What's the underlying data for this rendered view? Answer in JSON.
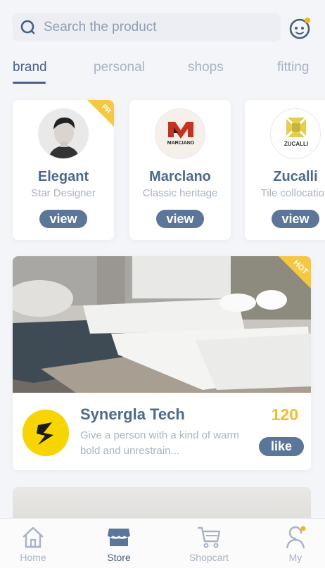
{
  "search": {
    "placeholder": "Search the product"
  },
  "tabs": [
    {
      "label": "brand",
      "active": true
    },
    {
      "label": "personal",
      "active": false
    },
    {
      "label": "shops",
      "active": false
    },
    {
      "label": "fitting",
      "active": false
    }
  ],
  "brands": [
    {
      "name": "Elegant",
      "subtitle": "Star Designer",
      "button": "view",
      "ribbon": "PR",
      "logo_icon": "person-portrait"
    },
    {
      "name": "Marclano",
      "subtitle": "Classic heritage",
      "button": "view",
      "logo_icon": "marciano-logo",
      "logo_text": "MARCIANO"
    },
    {
      "name": "Zucalli",
      "subtitle": "Tile collocation",
      "button": "view",
      "logo_icon": "zucalli-logo",
      "logo_text": "ZUCALLI"
    }
  ],
  "product": {
    "badge": "HOT",
    "company": "Synergla Tech",
    "description": "Give a person with a kind of warm bold and unrestrain...",
    "like_count": "120",
    "like_button": "like",
    "logo_icon": "lightning-s-logo"
  },
  "nav": [
    {
      "label": "Home",
      "icon": "home-icon",
      "active": false
    },
    {
      "label": "Store",
      "icon": "store-icon",
      "active": true
    },
    {
      "label": "Shopcart",
      "icon": "cart-icon",
      "active": false
    },
    {
      "label": "My",
      "icon": "profile-icon",
      "active": false
    }
  ],
  "colors": {
    "accent": "#47628a",
    "button": "#5b7699",
    "badge": "#f5c842",
    "like_count": "#f2bd33",
    "notification_dot": "#f2b51d"
  }
}
